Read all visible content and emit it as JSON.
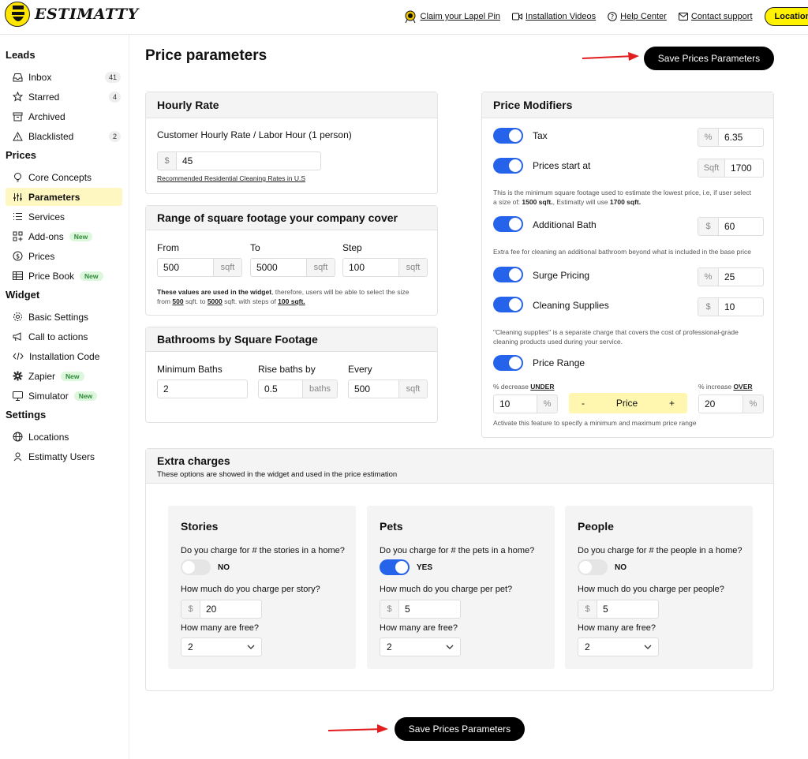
{
  "header": {
    "logo_text": "ESTIMATTY",
    "links": {
      "lapel": "Claim your Lapel Pin",
      "videos": "Installation Videos",
      "help": "Help Center",
      "contact": "Contact support"
    },
    "location_button": "Location:"
  },
  "sidebar": {
    "leads_heading": "Leads",
    "inbox": "Inbox",
    "inbox_count": "41",
    "starred": "Starred",
    "starred_count": "4",
    "archived": "Archived",
    "blacklisted": "Blacklisted",
    "blacklisted_count": "2",
    "prices_heading": "Prices",
    "core_concepts": "Core Concepts",
    "parameters": "Parameters",
    "services": "Services",
    "addons": "Add-ons",
    "prices": "Prices",
    "price_book": "Price Book",
    "widget_heading": "Widget",
    "basic_settings": "Basic Settings",
    "call_to_actions": "Call to actions",
    "installation_code": "Installation Code",
    "zapier": "Zapier",
    "simulator": "Simulator",
    "settings_heading": "Settings",
    "locations": "Locations",
    "estimatty_users": "Estimatty Users",
    "new_badge": "New"
  },
  "main": {
    "title": "Price parameters",
    "save_label": "Save Prices Parameters"
  },
  "hourly": {
    "title": "Hourly Rate",
    "label": "Customer Hourly Rate / Labor Hour (1 person)",
    "prefix": "$",
    "value": "45",
    "link": "Recommended Residential Cleaning Rates in U.S"
  },
  "range": {
    "title": "Range of square footage your company cover",
    "from_label": "From",
    "from_value": "500",
    "to_label": "To",
    "to_value": "5000",
    "step_label": "Step",
    "step_value": "100",
    "unit": "sqft",
    "note_bold": "These values are used in the widget",
    "note_1": ", therefore, users will be able to select the size",
    "note_2": "from",
    "note_from": "500",
    "note_3": "sqft. to",
    "note_to": "5000",
    "note_4": "sqft. with steps of",
    "note_step": "100 sqft."
  },
  "baths": {
    "title": "Bathrooms by Square Footage",
    "min_label": "Minimum Baths",
    "min_value": "2",
    "rise_label": "Rise baths by",
    "rise_value": "0.5",
    "rise_unit": "baths",
    "every_label": "Every",
    "every_value": "500",
    "every_unit": "sqft"
  },
  "modifiers": {
    "title": "Price Modifiers",
    "tax_label": "Tax",
    "tax_prefix": "%",
    "tax_value": "6.35",
    "start_label": "Prices start at",
    "start_prefix": "Sqft",
    "start_value": "1700",
    "start_note_1": "This is the minimum square footage used to estimate the lowest price, i.e, if user select",
    "start_note_2": "a size of:",
    "start_note_b1": "1500 sqft.",
    "start_note_3": ", Estimatty will use",
    "start_note_b2": "1700 sqft.",
    "bath_label": "Additional Bath",
    "bath_prefix": "$",
    "bath_value": "60",
    "bath_note": "Extra fee for cleaning an additional bathroom beyond what is included in the base price",
    "surge_label": "Surge Pricing",
    "surge_prefix": "%",
    "surge_value": "25",
    "supplies_label": "Cleaning Supplies",
    "supplies_prefix": "$",
    "supplies_value": "10",
    "supplies_note_1": "\"Cleaning supplies\" is a separate charge that covers the cost of professional-grade",
    "supplies_note_2": "cleaning products used during your service.",
    "range_label": "Price Range",
    "decrease_label": "% decrease",
    "decrease_word": "UNDER",
    "increase_label": "% increase",
    "increase_word": "OVER",
    "decrease_value": "10",
    "increase_value": "20",
    "pct": "%",
    "price_minus": "-",
    "price_text": "Price",
    "price_plus": "+",
    "range_note": "Activate this feature to specify a minimum and maximum price range"
  },
  "extra": {
    "title": "Extra charges",
    "subtitle": "These options are showed in the widget and used in the price estimation",
    "stories": {
      "title": "Stories",
      "question": "Do you charge for # the stories in a home?",
      "toggle_text": "NO",
      "charge_q": "How much do you charge per story?",
      "prefix": "$",
      "value": "20",
      "free_q": "How many are free?",
      "free_value": "2"
    },
    "pets": {
      "title": "Pets",
      "question": "Do you charge for # the pets in a home?",
      "toggle_text": "YES",
      "charge_q": "How much do you charge per pet?",
      "prefix": "$",
      "value": "5",
      "free_q": "How many are free?",
      "free_value": "2"
    },
    "people": {
      "title": "People",
      "question": "Do you charge for # the people in a home?",
      "toggle_text": "NO",
      "charge_q": "How much do you charge per people?",
      "prefix": "$",
      "value": "5",
      "free_q": "How many are free?",
      "free_value": "2"
    }
  },
  "colors": {
    "accent": "#2563eb",
    "highlight": "#fff200",
    "active_bg": "#fff7c2",
    "arrow": "#e11d1d"
  }
}
